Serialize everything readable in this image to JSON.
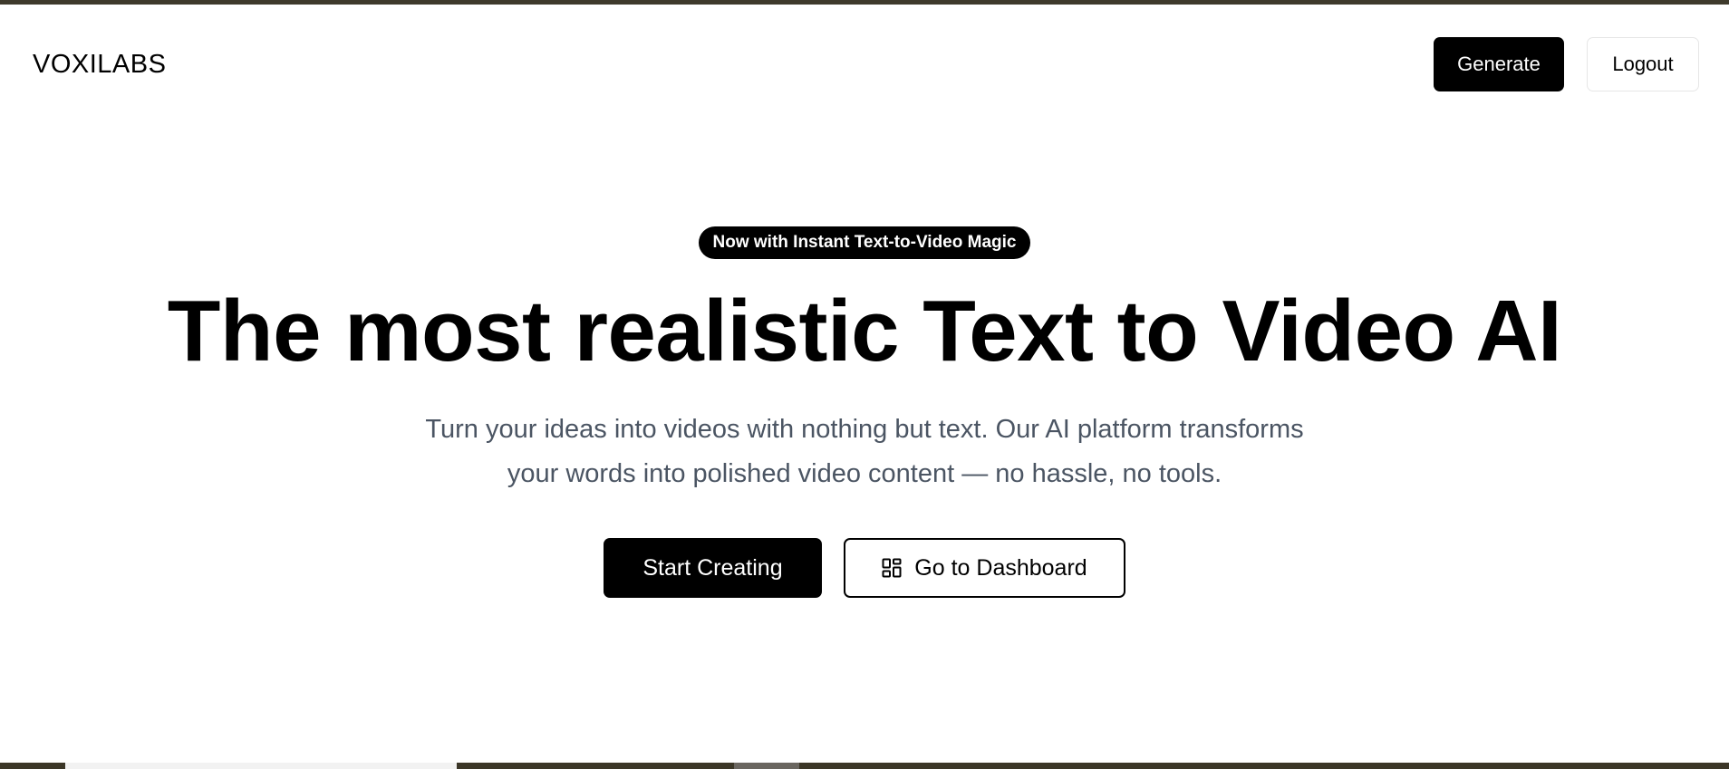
{
  "header": {
    "logo": "VOXILABS",
    "generate_label": "Generate",
    "logout_label": "Logout"
  },
  "hero": {
    "badge": "Now with Instant Text-to-Video Magic",
    "headline": "The most realistic Text to Video AI",
    "subtext_line1": "Turn your ideas into videos with nothing but text. Our AI platform transforms",
    "subtext_line2": "your words into polished video content — no hassle, no tools.",
    "start_label": "Start Creating",
    "dashboard_label": "Go to Dashboard",
    "dashboard_icon": "dashboard-grid-icon"
  },
  "colors": {
    "primary": "#000000",
    "background": "#ffffff",
    "subtext": "#4b5563",
    "top_strip": "#3e3a2c"
  }
}
